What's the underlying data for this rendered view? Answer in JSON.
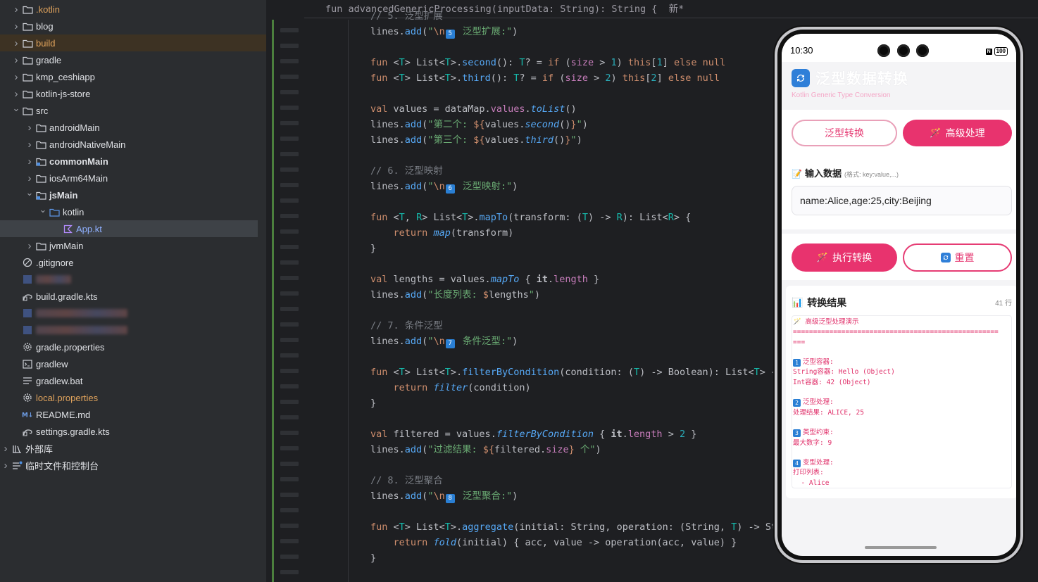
{
  "tree": [
    {
      "label": ".kotlin",
      "icon": "folder-icon",
      "depth": 1,
      "chev": "right",
      "style": "orange"
    },
    {
      "label": "blog",
      "icon": "folder-icon",
      "depth": 1,
      "chev": "right",
      "style": ""
    },
    {
      "label": "build",
      "icon": "folder-icon",
      "depth": 1,
      "chev": "right",
      "style": "orange",
      "selected": "build"
    },
    {
      "label": "gradle",
      "icon": "folder-icon",
      "depth": 1,
      "chev": "right",
      "style": ""
    },
    {
      "label": "kmp_ceshiapp",
      "icon": "folder-icon",
      "depth": 1,
      "chev": "right",
      "style": ""
    },
    {
      "label": "kotlin-js-store",
      "icon": "folder-icon",
      "depth": 1,
      "chev": "right",
      "style": ""
    },
    {
      "label": "src",
      "icon": "folder-icon",
      "depth": 1,
      "chev": "down",
      "style": ""
    },
    {
      "label": "androidMain",
      "icon": "folder-icon",
      "depth": 2,
      "chev": "right",
      "style": ""
    },
    {
      "label": "androidNativeMain",
      "icon": "folder-icon",
      "depth": 2,
      "chev": "right",
      "style": ""
    },
    {
      "label": "commonMain",
      "icon": "module-folder-icon",
      "depth": 2,
      "chev": "right",
      "style": "bold"
    },
    {
      "label": "iosArm64Main",
      "icon": "folder-icon",
      "depth": 2,
      "chev": "right",
      "style": ""
    },
    {
      "label": "jsMain",
      "icon": "module-folder-icon",
      "depth": 2,
      "chev": "down",
      "style": "bold"
    },
    {
      "label": "kotlin",
      "icon": "source-folder-icon",
      "depth": 3,
      "chev": "down",
      "style": ""
    },
    {
      "label": "App.kt",
      "icon": "kotlin-file-icon",
      "depth": 4,
      "chev": "",
      "style": "blue",
      "selected": "app"
    },
    {
      "label": "jvmMain",
      "icon": "folder-icon",
      "depth": 2,
      "chev": "right",
      "style": ""
    },
    {
      "label": ".gitignore",
      "icon": "ignore-file-icon",
      "depth": 1,
      "chev": "",
      "style": ""
    },
    {
      "label": "",
      "icon": "blurred-file-icon",
      "depth": 1,
      "chev": "",
      "style": "",
      "blur": 50
    },
    {
      "label": "build.gradle.kts",
      "icon": "gradle-file-icon",
      "depth": 1,
      "chev": "",
      "style": ""
    },
    {
      "label": "",
      "icon": "blurred-file-icon",
      "depth": 1,
      "chev": "",
      "style": "",
      "blur": 130
    },
    {
      "label": "",
      "icon": "blurred-file-icon",
      "depth": 1,
      "chev": "",
      "style": "",
      "blur": 130
    },
    {
      "label": "gradle.properties",
      "icon": "settings-file-icon",
      "depth": 1,
      "chev": "",
      "style": ""
    },
    {
      "label": "gradlew",
      "icon": "terminal-file-icon",
      "depth": 1,
      "chev": "",
      "style": ""
    },
    {
      "label": "gradlew.bat",
      "icon": "text-file-icon",
      "depth": 1,
      "chev": "",
      "style": ""
    },
    {
      "label": "local.properties",
      "icon": "settings-file-icon",
      "depth": 1,
      "chev": "",
      "style": "orange"
    },
    {
      "label": "README.md",
      "icon": "markdown-file-icon",
      "depth": 1,
      "chev": "",
      "style": ""
    },
    {
      "label": "settings.gradle.kts",
      "icon": "gradle-file-icon",
      "depth": 1,
      "chev": "",
      "style": ""
    },
    {
      "label": "外部库",
      "icon": "library-icon",
      "depth": 0,
      "chev": "right",
      "style": ""
    },
    {
      "label": "临时文件和控制台",
      "icon": "scratch-icon",
      "depth": 0,
      "chev": "right",
      "style": ""
    }
  ],
  "editor": {
    "sticky_header": "fun advancedGenericProcessing(inputData: String): String {  新*",
    "lines": [
      "<span class='cm'>// 5. 泛型扩展</span>",
      "lines.<span class='fn'>add</span>(<span class='str'>\"<span class='esc'>\\n</span><span class='emo'>5</span> 泛型扩展:\"</span>)",
      "",
      "<span class='kw'>fun</span> &lt;<span class='tp'>T</span>&gt; List&lt;<span class='tp'>T</span>&gt;.<span class='fn'>second</span>(): <span class='tp'>T</span>? = <span class='kw'>if</span> (<span class='prop'>size</span> &gt; <span class='num'>1</span>) <span class='kw'>this</span>[<span class='num'>1</span>] <span class='kw'>else null</span>",
      "<span class='kw'>fun</span> &lt;<span class='tp'>T</span>&gt; List&lt;<span class='tp'>T</span>&gt;.<span class='fn'>third</span>(): <span class='tp'>T</span>? = <span class='kw'>if</span> (<span class='prop'>size</span> &gt; <span class='num'>2</span>) <span class='kw'>this</span>[<span class='num'>2</span>] <span class='kw'>else null</span>",
      "",
      "<span class='kw'>val</span> values = dataMap.<span class='prop'>values</span>.<span class='it'>toList</span>()",
      "lines.<span class='fn'>add</span>(<span class='str'>\"第二个: </span><span class='esc'>${</span>values.<span class='it'>second</span>()<span class='esc'>}</span><span class='str'>\"</span>)",
      "lines.<span class='fn'>add</span>(<span class='str'>\"第三个: </span><span class='esc'>${</span>values.<span class='it'>third</span>()<span class='esc'>}</span><span class='str'>\"</span>)",
      "",
      "<span class='cm'>// 6. 泛型映射</span>",
      "lines.<span class='fn'>add</span>(<span class='str'>\"<span class='esc'>\\n</span><span class='emo'>6</span> 泛型映射:\"</span>)",
      "",
      "<span class='kw'>fun</span> &lt;<span class='tp'>T</span>, <span class='tp'>R</span>&gt; List&lt;<span class='tp'>T</span>&gt;.<span class='fn'>mapTo</span>(transform: (<span class='tp'>T</span>) -&gt; <span class='tp'>R</span>): List&lt;<span class='tp'>R</span>&gt; {",
      "    <span class='kw'>return</span> <span class='it'>map</span>(transform)",
      "}",
      "",
      "<span class='kw'>val</span> lengths = values.<span class='it'>mapTo</span> { <b>it</b>.<span class='prop'>length</span> }",
      "lines.<span class='fn'>add</span>(<span class='str'>\"长度列表: </span><span class='esc'>$</span>lengths<span class='str'>\"</span>)",
      "",
      "<span class='cm'>// 7. 条件泛型</span>",
      "lines.<span class='fn'>add</span>(<span class='str'>\"<span class='esc'>\\n</span><span class='emo'>7</span> 条件泛型:\"</span>)",
      "",
      "<span class='kw'>fun</span> &lt;<span class='tp'>T</span>&gt; List&lt;<span class='tp'>T</span>&gt;.<span class='fn'>filterByCondition</span>(condition: (<span class='tp'>T</span>) -&gt; Boolean): List&lt;<span class='tp'>T</span>&gt; {",
      "    <span class='kw'>return</span> <span class='it'>filter</span>(condition)",
      "}",
      "",
      "<span class='kw'>val</span> filtered = values.<span class='it'>filterByCondition</span> { <b>it</b>.<span class='prop'>length</span> &gt; <span class='num'>2</span> }",
      "lines.<span class='fn'>add</span>(<span class='str'>\"过滤结果: </span><span class='esc'>${</span>filtered.<span class='prop'>size</span><span class='esc'>}</span><span class='str'> 个\"</span>)",
      "",
      "<span class='cm'>// 8. 泛型聚合</span>",
      "lines.<span class='fn'>add</span>(<span class='str'>\"<span class='esc'>\\n</span><span class='emo'>8</span> 泛型聚合:\"</span>)",
      "",
      "<span class='kw'>fun</span> &lt;<span class='tp'>T</span>&gt; List&lt;<span class='tp'>T</span>&gt;.<span class='fn'>aggregate</span>(initial: String, operation: (String, <span class='tp'>T</span>) -&gt; Str",
      "    <span class='kw'>return</span> <span class='it'>fold</span>(initial) { acc, value -&gt; operation(acc, value) }",
      "}"
    ]
  },
  "phone": {
    "time": "10:30",
    "battery": "100",
    "app_title": "泛型数据转换",
    "app_subtitle": "Kotlin Generic Type Conversion",
    "tab_generic": "泛型转换",
    "tab_advanced": "高级处理",
    "input_label": "输入数据",
    "input_hint": "(格式: key:value,...)",
    "input_value": "name:Alice,age:25,city:Beijing",
    "run_button": "执行转换",
    "reset_button": "重置",
    "result_title": "转换结果",
    "result_count": "41 行",
    "result_lines": [
      "🪄 高级泛型处理演示",
      "===================================================",
      "===",
      "",
      "#1 泛型容器:",
      "String容器: Hello (Object)",
      "Int容器: 42 (Object)",
      "",
      "#2 泛型处理:",
      "处理结果: ALICE, 25",
      "",
      "#3 类型约束:",
      "最大数字: 9",
      "",
      "#4 变型处理:",
      "打印列表:",
      "  - Alice"
    ]
  },
  "colors": {
    "accent": "#e8336e",
    "ide_bg": "#1e1f22",
    "tree_bg": "#2b2d30"
  }
}
